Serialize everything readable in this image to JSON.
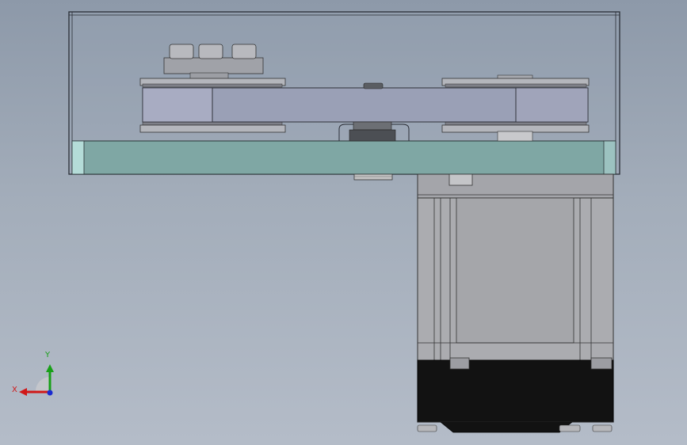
{
  "colors": {
    "background_top": "#8d99a9",
    "background_bottom": "#b4bcc8",
    "enclosure_edge": "#2a2e36",
    "base_plate": "#7fa7a4",
    "motor_body": "#a9aaae",
    "motor_cap": "#121212",
    "belt": "#9aa0b6",
    "axis_x": "#d01818",
    "axis_y": "#18a018",
    "axis_z": "#1a2ad0"
  },
  "triad": {
    "x_label": "X",
    "y_label": "Y"
  },
  "icons": {
    "triad": "coordinate-triad-icon"
  }
}
